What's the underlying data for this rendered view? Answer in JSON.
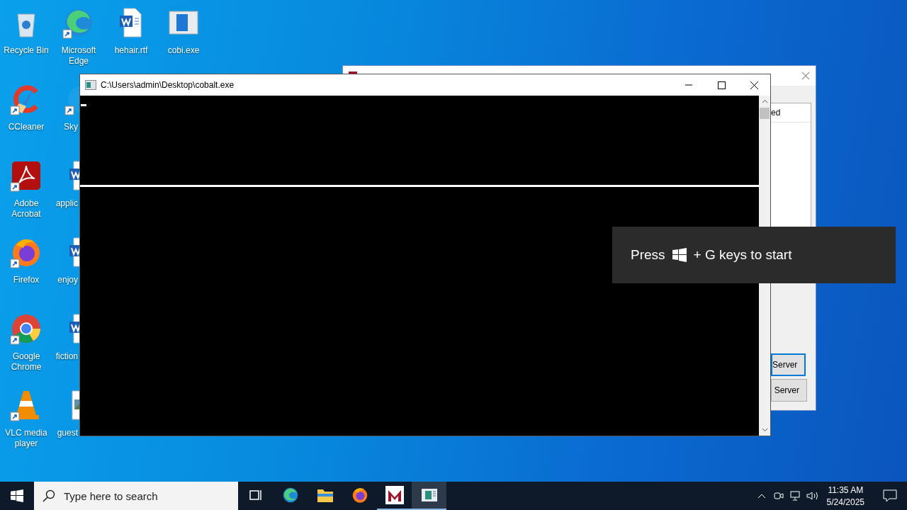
{
  "desktop_icons": [
    {
      "label": "Recycle Bin",
      "kind": "recycle",
      "shortcut": false
    },
    {
      "label": "CCleaner",
      "kind": "ccleaner",
      "shortcut": true
    },
    {
      "label": "Adobe Acrobat",
      "kind": "acrobat",
      "shortcut": true
    },
    {
      "label": "Firefox",
      "kind": "firefox",
      "shortcut": true
    },
    {
      "label": "Google Chrome",
      "kind": "chrome",
      "shortcut": true
    },
    {
      "label": "VLC media player",
      "kind": "vlc",
      "shortcut": true
    },
    {
      "label": "Microsoft Edge",
      "kind": "edge",
      "shortcut": true
    },
    {
      "label": "Sky",
      "kind": "skype",
      "shortcut": true
    },
    {
      "label": "applic",
      "kind": "word",
      "shortcut": false
    },
    {
      "label": "enjoy",
      "kind": "word",
      "shortcut": false
    },
    {
      "label": "fiction",
      "kind": "word",
      "shortcut": false
    },
    {
      "label": "guest",
      "kind": "image",
      "shortcut": false
    },
    {
      "label": "hehair.rtf",
      "kind": "word",
      "shortcut": false
    },
    {
      "label": "cobi.exe",
      "kind": "exe",
      "shortcut": false
    }
  ],
  "back_window": {
    "list_header": "ed",
    "buttons": [
      {
        "label": "Server",
        "focused": true
      },
      {
        "label": "Server",
        "focused": false
      }
    ]
  },
  "console_window": {
    "title": "C:\\Users\\admin\\Desktop\\cobalt.exe"
  },
  "toast": {
    "before": "Press",
    "after": "+ G keys to start"
  },
  "taskbar": {
    "search": {
      "placeholder": "Type here to search"
    },
    "apps": [
      {
        "kind": "taskview",
        "running": false,
        "selected": false
      },
      {
        "kind": "edge",
        "running": false,
        "selected": false
      },
      {
        "kind": "explorer",
        "running": false,
        "selected": false
      },
      {
        "kind": "firefox",
        "running": false,
        "selected": false
      },
      {
        "kind": "mapp",
        "running": true,
        "selected": false
      },
      {
        "kind": "console",
        "running": true,
        "selected": true
      }
    ],
    "time": "11:35 AM",
    "date": "5/24/2025"
  }
}
